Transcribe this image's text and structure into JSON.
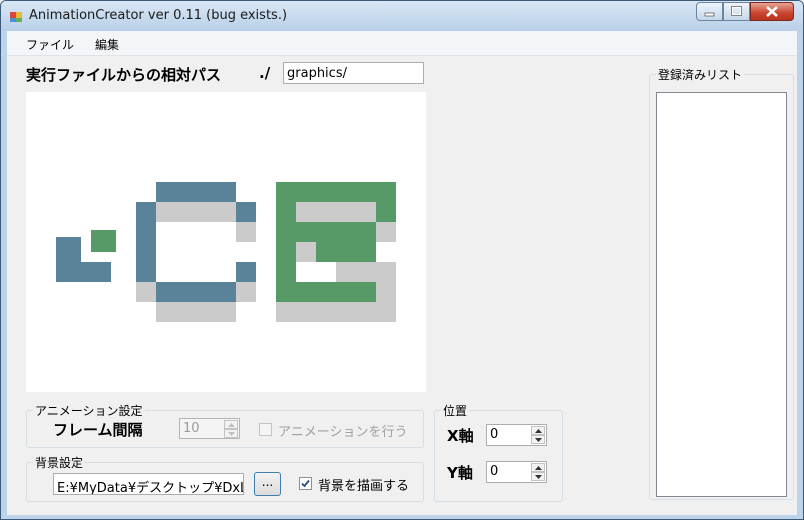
{
  "window": {
    "title": "AnimationCreator ver 0.11 (bug exists.)"
  },
  "menu": {
    "items": [
      "ファイル",
      "編集"
    ]
  },
  "path": {
    "label": "実行ファイルからの相対パス",
    "prefix": "./",
    "value": "graphics/"
  },
  "animation": {
    "group_title": "アニメーション設定",
    "frame_label": "フレーム間隔",
    "frame_value": "10",
    "animate_label": "アニメーションを行う",
    "animate_checked": false
  },
  "background": {
    "group_title": "背景設定",
    "path_value": "E:¥MyData¥デスクトップ¥DxL",
    "browse_label": "...",
    "draw_label": "背景を描画する",
    "draw_checked": true
  },
  "position": {
    "group_title": "位置",
    "x_label": "X軸",
    "x_value": "0",
    "y_label": "Y軸",
    "y_value": "0"
  },
  "registered": {
    "group_title": "登録済みリスト"
  },
  "colors": {
    "logo_blue": "#5a8298",
    "logo_green": "#579a68",
    "logo_shadow": "#cbcbcb"
  }
}
